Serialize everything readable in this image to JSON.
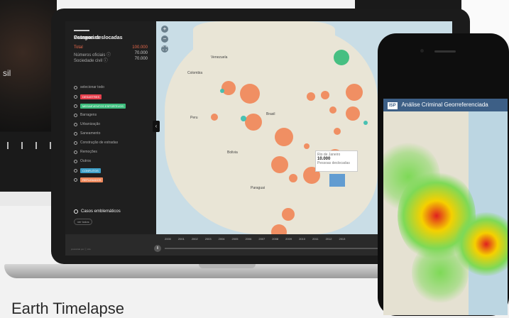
{
  "caption": "Earth Timelapse",
  "background_monitor": {
    "label": "sil"
  },
  "laptop": {
    "panel": {
      "title": "Pessoas deslocadas",
      "stats": [
        {
          "label": "Total",
          "value": "100.000"
        },
        {
          "label": "Números oficiais ⓘ",
          "value": "70.000"
        },
        {
          "label": "Sociedade civil ⓘ",
          "value": "70.000"
        }
      ],
      "categories_title": "Categorias",
      "categories": [
        {
          "label": "selecionar todo",
          "tag": false,
          "color": ""
        },
        {
          "label": "DESASTRES",
          "tag": true,
          "color": "#e5404d"
        },
        {
          "label": "MEGAEVENTOS ESPORTIVOS",
          "tag": true,
          "color": "#3dbd7d"
        },
        {
          "label": "Barragens",
          "tag": false,
          "color": ""
        },
        {
          "label": "Urbanização",
          "tag": false,
          "color": ""
        },
        {
          "label": "Saneamento",
          "tag": false,
          "color": ""
        },
        {
          "label": "Construção de estradas",
          "tag": false,
          "color": ""
        },
        {
          "label": "Remoções",
          "tag": false,
          "color": ""
        },
        {
          "label": "Outros",
          "tag": false,
          "color": ""
        },
        {
          "label": "CONFLITOS",
          "tag": true,
          "color": "#3fa0c8"
        },
        {
          "label": "REFUGIADOS",
          "tag": true,
          "color": "#f08a5d"
        }
      ],
      "emblematic": "Casos emblemáticos",
      "small_button": "ver todos"
    },
    "map_labels": [
      "Venezuela",
      "Colombia",
      "Peru",
      "Brasil",
      "Bolivia",
      "Paraguai"
    ],
    "tooltip": {
      "title": "Rio de Janeiro",
      "value": "10.000",
      "subtitle": "Pessoas deslocadas"
    },
    "timeline": {
      "years": [
        "2000",
        "2001",
        "2002",
        "2003",
        "2004",
        "2005",
        "2006",
        "2007",
        "2008",
        "2009",
        "2010",
        "2011",
        "2012",
        "2013"
      ],
      "play_label": "II",
      "credit": "produzido por ⓘ info"
    },
    "zoom_in": "+",
    "zoom_out": "−",
    "fullscreen": "⛶",
    "collapse": "‹"
  },
  "phone": {
    "logo": "ISP",
    "title": "Análise Criminal Georreferenciada"
  },
  "colors": {
    "bubble": "#f08a5d",
    "teal": "#3fbfb0",
    "phone_header": "#3d5f86"
  }
}
